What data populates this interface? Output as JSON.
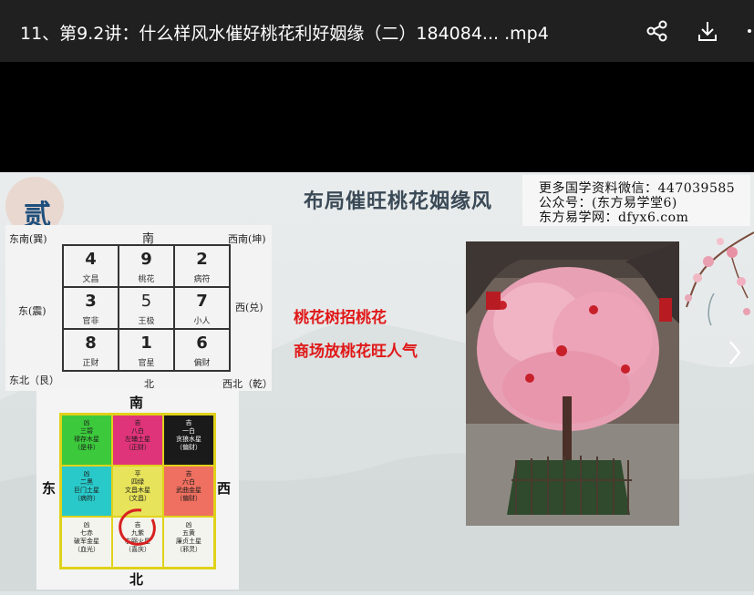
{
  "player": {
    "title": "11、第9.2讲：什么样风水催好桃花利好姻缘（二）184084... .mp4",
    "icons": [
      "share-icon",
      "download-icon",
      "more-icon"
    ]
  },
  "slide": {
    "badge": "贰",
    "title": "布局催旺桃花姻缘风",
    "watermark": [
      "更多国学资料微信：447039585",
      "公众号：(东方易学堂6)",
      "东方易学网：dfyx6.com"
    ],
    "red_lines": [
      "桃花树招桃花",
      "商场放桃花旺人气"
    ],
    "next_icon": "chevron-right-icon"
  },
  "grid1": {
    "directions": {
      "se": "东南(巽)",
      "s": "南",
      "sw": "西南(坤)",
      "e": "东(震)",
      "w": "西(兑)",
      "ne": "东北（艮）",
      "n": "北",
      "nw": "西北（乾）"
    },
    "cells": [
      {
        "num": "4",
        "label": "文昌"
      },
      {
        "num": "9",
        "label": "桃花"
      },
      {
        "num": "2",
        "label": "病符"
      },
      {
        "num": "3",
        "label": "官非"
      },
      {
        "num": "5",
        "label": "王极"
      },
      {
        "num": "7",
        "label": "小人"
      },
      {
        "num": "8",
        "label": "正财"
      },
      {
        "num": "1",
        "label": "官星"
      },
      {
        "num": "6",
        "label": "偏财"
      }
    ]
  },
  "grid2": {
    "directions": {
      "n": "北",
      "s": "南",
      "e": "东",
      "w": "西"
    },
    "cells": [
      {
        "text": "凶\n三碧\n禄存木星\n（是非）",
        "bg": "#3cc93c",
        "color": "#1a1a1a"
      },
      {
        "text": "吉\n八白\n左辅土星\n（正财）",
        "bg": "#e0347a",
        "color": "#1a1a1a"
      },
      {
        "text": "吉\n一白\n贪狼水星\n（偏财）",
        "bg": "#1a1a1a",
        "color": "#ffffff"
      },
      {
        "text": "凶\n二黑\n巨门土星\n（病符）",
        "bg": "#2ac9c9",
        "color": "#1a1a1a"
      },
      {
        "text": "平\n四绿\n文昌木星\n（文昌）",
        "bg": "#e7e35a",
        "color": "#1a1a1a"
      },
      {
        "text": "吉\n六白\n武曲金星\n（偏财）",
        "bg": "#ef7060",
        "color": "#1a1a1a"
      },
      {
        "text": "凶\n七赤\n破军金星\n（血光）",
        "bg": "#f4f4ee",
        "color": "#1a1a1a"
      },
      {
        "text": "吉\n九紫\n右弼火星\n（喜庆）",
        "bg": "#f4f4ee",
        "color": "#1a1a1a"
      },
      {
        "text": "凶\n五黄\n廉贞土星\n（邪灵）",
        "bg": "#f4f4ee",
        "color": "#1a1a1a"
      }
    ]
  },
  "colors": {
    "accent_red": "#e01818",
    "title_blue": "#1e4f7d"
  }
}
